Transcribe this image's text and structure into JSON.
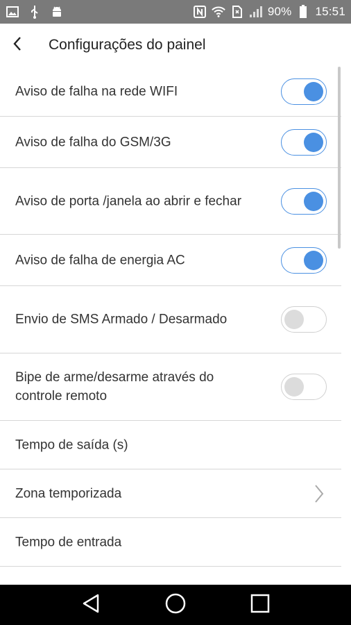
{
  "status_bar": {
    "icons_left": [
      "image-icon",
      "usb-icon",
      "android-icon"
    ],
    "icons_right": [
      "nfc-icon",
      "wifi-icon",
      "sim-icon",
      "signal-icon",
      "battery-icon"
    ],
    "battery": "90%",
    "time": "15:51"
  },
  "header": {
    "back_icon": "chevron-left-icon",
    "title": "Configurações do painel"
  },
  "settings": [
    {
      "label": "Aviso de falha na rede WIFI",
      "type": "toggle",
      "on": true
    },
    {
      "label": "Aviso de falha do GSM/3G",
      "type": "toggle",
      "on": true
    },
    {
      "label": "Aviso de porta /janela ao abrir e fechar",
      "type": "toggle",
      "on": true
    },
    {
      "label": "Aviso de falha de energia AC",
      "type": "toggle",
      "on": true
    },
    {
      "label": "Envio de SMS Armado / Desarmado",
      "type": "toggle",
      "on": false
    },
    {
      "label": "Bipe de arme/desarme através do controle remoto",
      "type": "toggle",
      "on": false
    },
    {
      "label": "Tempo de saída (s)",
      "type": "plain"
    },
    {
      "label": "Zona temporizada",
      "type": "chevron"
    },
    {
      "label": "Tempo de entrada",
      "type": "plain"
    }
  ],
  "colors": {
    "accent": "#4a90e2",
    "toggle_off": "#dcdcdc",
    "status_bar": "#7a7a7a",
    "nav_bar": "#000000"
  },
  "nav_bar": {
    "icons": [
      "back-triangle-icon",
      "home-circle-icon",
      "recents-square-icon"
    ]
  }
}
